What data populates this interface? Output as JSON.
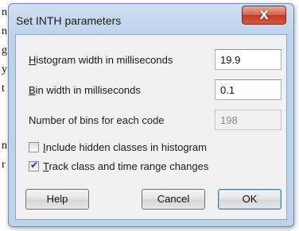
{
  "background_doc": {
    "left_letters": [
      "n",
      "n",
      "g",
      "y",
      "t",
      "",
      "n",
      "r"
    ],
    "right_letters": [
      "",
      "",
      "",
      "",
      ""
    ]
  },
  "dialog": {
    "title": "Set INTH parameters",
    "close_glyph": "X",
    "fields": [
      {
        "label_accel": "H",
        "label_rest": "istogram width in milliseconds",
        "value": "19.9",
        "enabled": true
      },
      {
        "label_accel": "B",
        "label_rest": "in width in milliseconds",
        "value": "0.1",
        "enabled": true
      },
      {
        "label_accel": "",
        "label_rest": "Number of bins for each code",
        "value": "198",
        "enabled": false
      }
    ],
    "checkboxes": [
      {
        "accel": "I",
        "rest": "nclude hidden classes in histogram",
        "checked": false
      },
      {
        "accel": "T",
        "rest": "rack class and time range changes",
        "checked": true
      }
    ],
    "buttons": {
      "help": "Help",
      "cancel": "Cancel",
      "ok": "OK"
    }
  },
  "colors": {
    "frame": "#bcd3ea",
    "close": "#c23a24",
    "default_button_border": "#3c7fb1"
  }
}
